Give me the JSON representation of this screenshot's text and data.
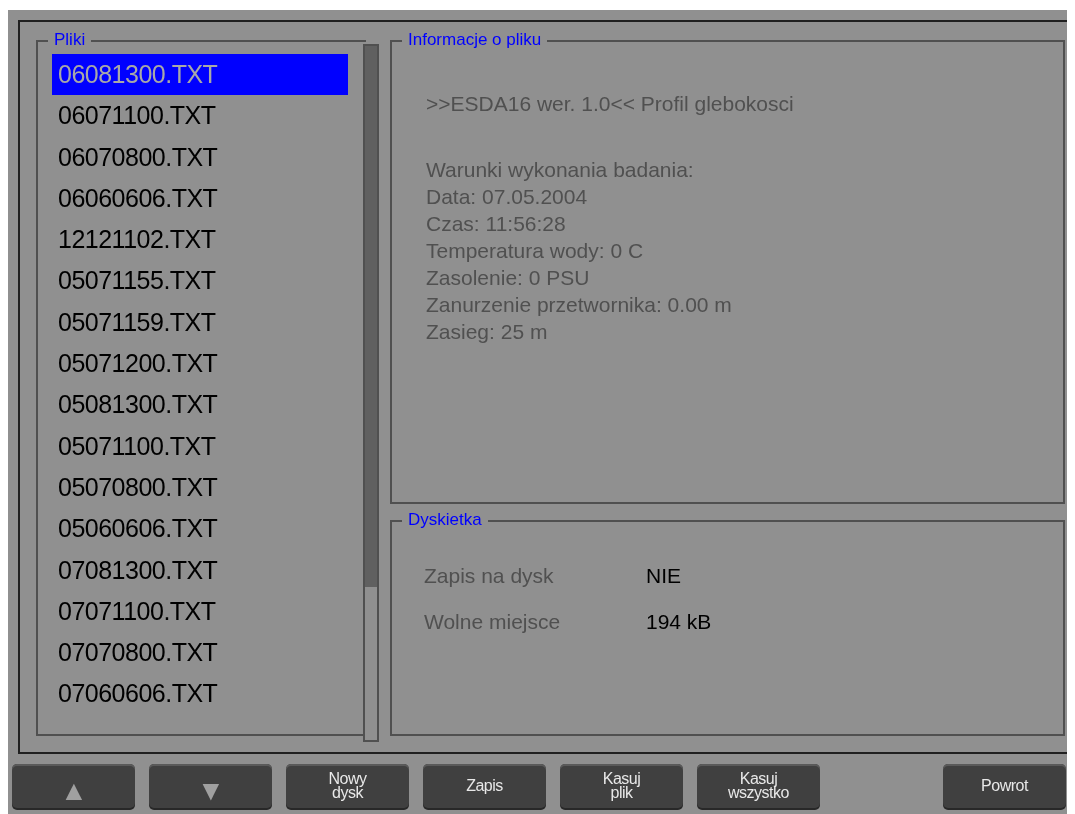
{
  "files_panel": {
    "title": "Pliki",
    "files": [
      {
        "name": "06081300.TXT",
        "selected": true
      },
      {
        "name": "06071100.TXT",
        "selected": false
      },
      {
        "name": "06070800.TXT",
        "selected": false
      },
      {
        "name": "06060606.TXT",
        "selected": false
      },
      {
        "name": "12121102.TXT",
        "selected": false
      },
      {
        "name": "05071155.TXT",
        "selected": false
      },
      {
        "name": "05071159.TXT",
        "selected": false
      },
      {
        "name": "05071200.TXT",
        "selected": false
      },
      {
        "name": "05081300.TXT",
        "selected": false
      },
      {
        "name": "05071100.TXT",
        "selected": false
      },
      {
        "name": "05070800.TXT",
        "selected": false
      },
      {
        "name": "05060606.TXT",
        "selected": false
      },
      {
        "name": "07081300.TXT",
        "selected": false
      },
      {
        "name": "07071100.TXT",
        "selected": false
      },
      {
        "name": "07070800.TXT",
        "selected": false
      },
      {
        "name": "07060606.TXT",
        "selected": false
      }
    ]
  },
  "file_info": {
    "title": "Informacje o pliku",
    "header": ">>ESDA16 wer. 1.0<< Profil glebokosci",
    "lines": [
      "Warunki wykonania badania:",
      "Data: 07.05.2004",
      "Czas: 11:56:28",
      "Temperatura wody:  0 C",
      "Zasolenie: 0 PSU",
      "Zanurzenie przetwornika: 0.00 m",
      "Zasieg: 25 m"
    ]
  },
  "disk": {
    "title": "Dyskietka",
    "rows": [
      {
        "label": "Zapis na dysk",
        "value": "NIE"
      },
      {
        "label": "Wolne miejsce",
        "value": "194 kB"
      }
    ]
  },
  "buttons": [
    {
      "kind": "glyph",
      "label": "▲"
    },
    {
      "kind": "glyph",
      "label": "▼"
    },
    {
      "kind": "text",
      "label": "Nowy\ndysk"
    },
    {
      "kind": "text",
      "label": "Zapis"
    },
    {
      "kind": "text",
      "label": "Kasuj\nplik"
    },
    {
      "kind": "text",
      "label": "Kasuj\nwszystko"
    },
    {
      "kind": "gap"
    },
    {
      "kind": "text",
      "label": "Powrot"
    }
  ]
}
